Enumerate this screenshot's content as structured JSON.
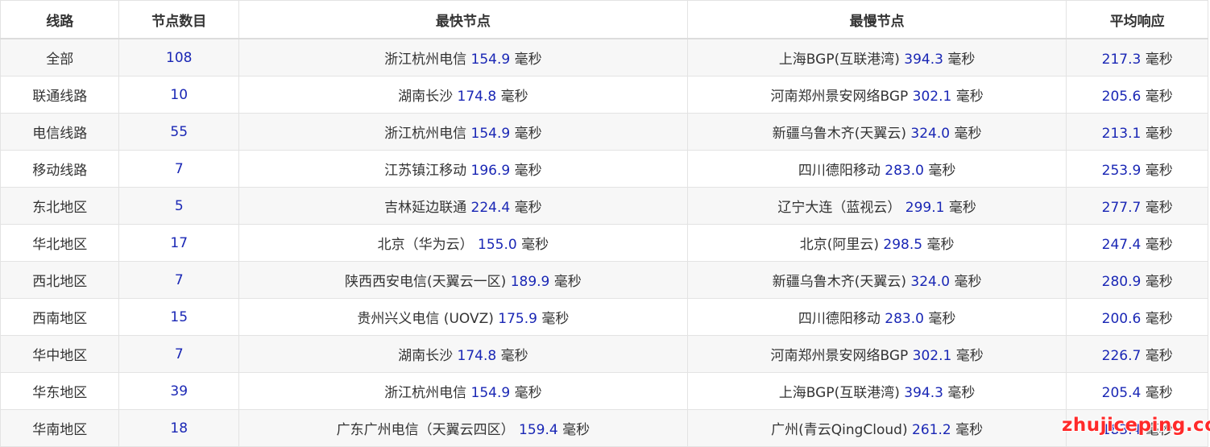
{
  "headers": [
    "线路",
    "节点数目",
    "最快节点",
    "最慢节点",
    "平均响应"
  ],
  "unit": "毫秒",
  "rows": [
    {
      "line": "全部",
      "count": "108",
      "fast_name": "浙江杭州电信",
      "fast_ms": "154.9",
      "slow_name": "上海BGP(互联港湾)",
      "slow_ms": "394.3",
      "avg_ms": "217.3"
    },
    {
      "line": "联通线路",
      "count": "10",
      "fast_name": "湖南长沙",
      "fast_ms": "174.8",
      "slow_name": "河南郑州景安网络BGP",
      "slow_ms": "302.1",
      "avg_ms": "205.6"
    },
    {
      "line": "电信线路",
      "count": "55",
      "fast_name": "浙江杭州电信",
      "fast_ms": "154.9",
      "slow_name": "新疆乌鲁木齐(天翼云)",
      "slow_ms": "324.0",
      "avg_ms": "213.1"
    },
    {
      "line": "移动线路",
      "count": "7",
      "fast_name": "江苏镇江移动",
      "fast_ms": "196.9",
      "slow_name": "四川德阳移动",
      "slow_ms": "283.0",
      "avg_ms": "253.9"
    },
    {
      "line": "东北地区",
      "count": "5",
      "fast_name": "吉林延边联通",
      "fast_ms": "224.4",
      "slow_name": "辽宁大连（蓝视云）",
      "slow_ms": "299.1",
      "avg_ms": "277.7"
    },
    {
      "line": "华北地区",
      "count": "17",
      "fast_name": "北京（华为云）",
      "fast_ms": "155.0",
      "slow_name": "北京(阿里云)",
      "slow_ms": "298.5",
      "avg_ms": "247.4"
    },
    {
      "line": "西北地区",
      "count": "7",
      "fast_name": "陕西西安电信(天翼云一区)",
      "fast_ms": "189.9",
      "slow_name": "新疆乌鲁木齐(天翼云)",
      "slow_ms": "324.0",
      "avg_ms": "280.9"
    },
    {
      "line": "西南地区",
      "count": "15",
      "fast_name": "贵州兴义电信 (UOVZ)",
      "fast_ms": "175.9",
      "slow_name": "四川德阳移动",
      "slow_ms": "283.0",
      "avg_ms": "200.6"
    },
    {
      "line": "华中地区",
      "count": "7",
      "fast_name": "湖南长沙",
      "fast_ms": "174.8",
      "slow_name": "河南郑州景安网络BGP",
      "slow_ms": "302.1",
      "avg_ms": "226.7"
    },
    {
      "line": "华东地区",
      "count": "39",
      "fast_name": "浙江杭州电信",
      "fast_ms": "154.9",
      "slow_name": "上海BGP(互联港湾)",
      "slow_ms": "394.3",
      "avg_ms": "205.4"
    },
    {
      "line": "华南地区",
      "count": "18",
      "fast_name": "广东广州电信（天翼云四区）",
      "fast_ms": "159.4",
      "slow_name": "广州(青云QingCloud)",
      "slow_ms": "261.2",
      "avg_ms": "183.4"
    }
  ],
  "watermark": "zhujiceping.com"
}
